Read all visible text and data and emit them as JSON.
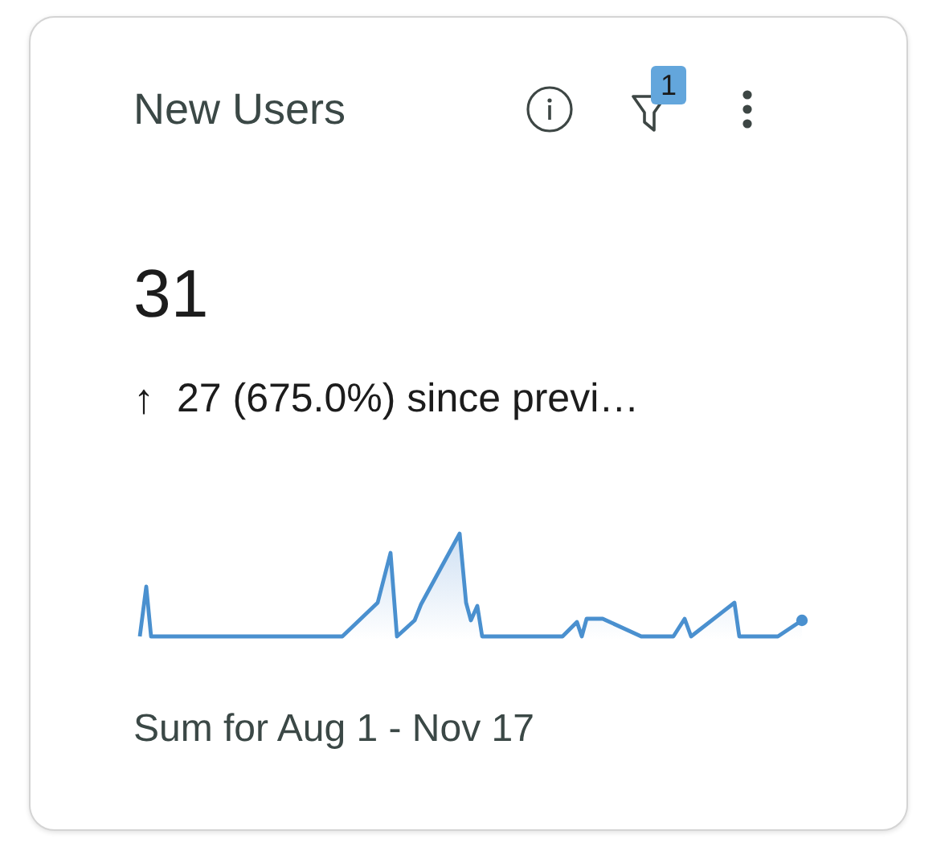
{
  "card": {
    "title": "New Users",
    "filter_count": "1",
    "value": "31",
    "change": {
      "arrow": "↑",
      "text": "27 (675.0%) since previ…"
    },
    "footer": "Sum for Aug 1 - Nov 17"
  }
}
